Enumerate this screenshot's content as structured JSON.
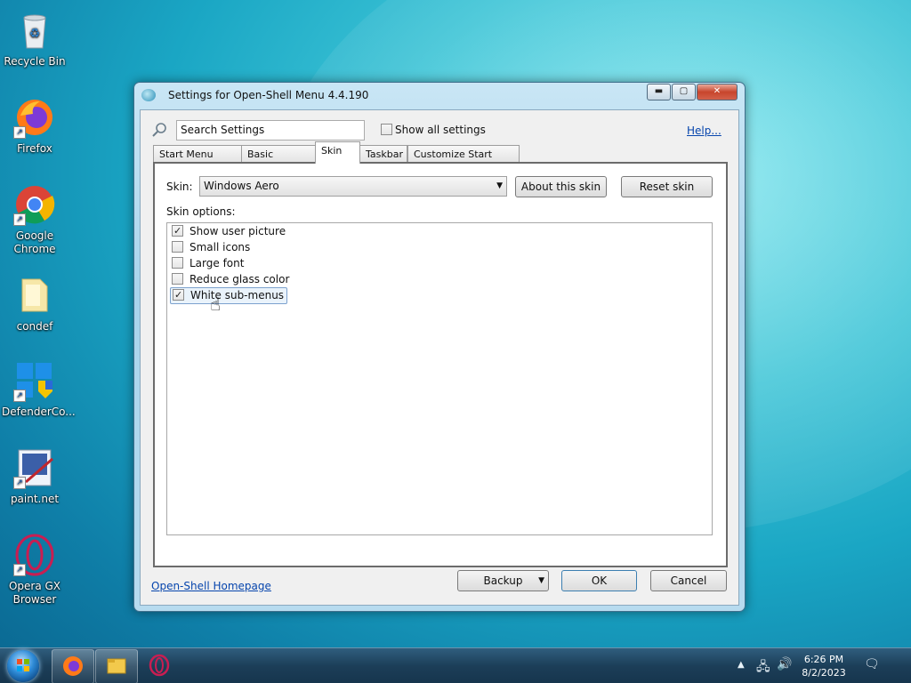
{
  "desktop": {
    "icons": [
      {
        "label": "Recycle Bin",
        "icon": "recycle-bin-icon"
      },
      {
        "label": "Firefox",
        "icon": "firefox-icon"
      },
      {
        "label": "Google Chrome",
        "icon": "chrome-icon"
      },
      {
        "label": "condef",
        "icon": "folder-icon"
      },
      {
        "label": "DefenderCo...",
        "icon": "defender-icon"
      },
      {
        "label": "paint.net",
        "icon": "paintnet-icon"
      },
      {
        "label": "Opera GX Browser",
        "icon": "opera-gx-icon"
      }
    ]
  },
  "window": {
    "title": "Settings for Open-Shell Menu 4.4.190",
    "controls": {
      "minimize": "▬",
      "maximize": "▢",
      "close": "✕"
    },
    "search": {
      "value": "Search Settings"
    },
    "show_all": {
      "label": "Show all settings",
      "checked": false
    },
    "help": "Help...",
    "tabs": [
      {
        "label": "Start Menu Style",
        "active": false
      },
      {
        "label": "Basic Settings",
        "active": false
      },
      {
        "label": "Skin",
        "active": true
      },
      {
        "label": "Taskbar",
        "active": false
      },
      {
        "label": "Customize Start Menu",
        "active": false
      }
    ],
    "skin": {
      "label": "Skin:",
      "selected": "Windows Aero",
      "about_button": "About this skin",
      "reset_button": "Reset skin",
      "options_label": "Skin options:",
      "options": [
        {
          "label": "Show user picture",
          "checked": true
        },
        {
          "label": "Small icons",
          "checked": false
        },
        {
          "label": "Large font",
          "checked": false
        },
        {
          "label": "Reduce glass color",
          "checked": false
        },
        {
          "label": "White sub-menus",
          "checked": true,
          "selected": true
        }
      ]
    },
    "footer": {
      "homepage": "Open-Shell Homepage",
      "backup": "Backup",
      "ok": "OK",
      "cancel": "Cancel"
    }
  },
  "taskbar": {
    "items": [
      "start-orb",
      "firefox-icon",
      "file-explorer-icon",
      "opera-gx-icon"
    ],
    "time": "6:26 PM",
    "date": "8/2/2023"
  },
  "colors": {
    "accent": "#0645ad",
    "taskbar": "#1c3e58"
  }
}
